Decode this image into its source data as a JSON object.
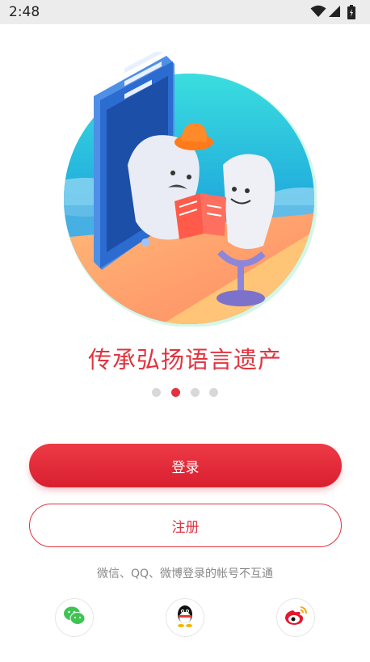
{
  "status_bar": {
    "time": "2:48",
    "icons": [
      "wifi-icon",
      "signal-icon",
      "battery-icon"
    ]
  },
  "hero": {
    "illustration": "phone-and-microphone-reading-book-illustration"
  },
  "carousel": {
    "slogan": "传承弘扬语言遗产",
    "page_count": 4,
    "active_index": 1
  },
  "actions": {
    "login_label": "登录",
    "register_label": "注册"
  },
  "third_party": {
    "notice": "微信、QQ、微博登录的帐号不互通",
    "providers": [
      "wechat-icon",
      "qq-icon",
      "weibo-icon"
    ]
  },
  "colors": {
    "accent": "#e13440",
    "status_bar_bg": "#ececec"
  }
}
